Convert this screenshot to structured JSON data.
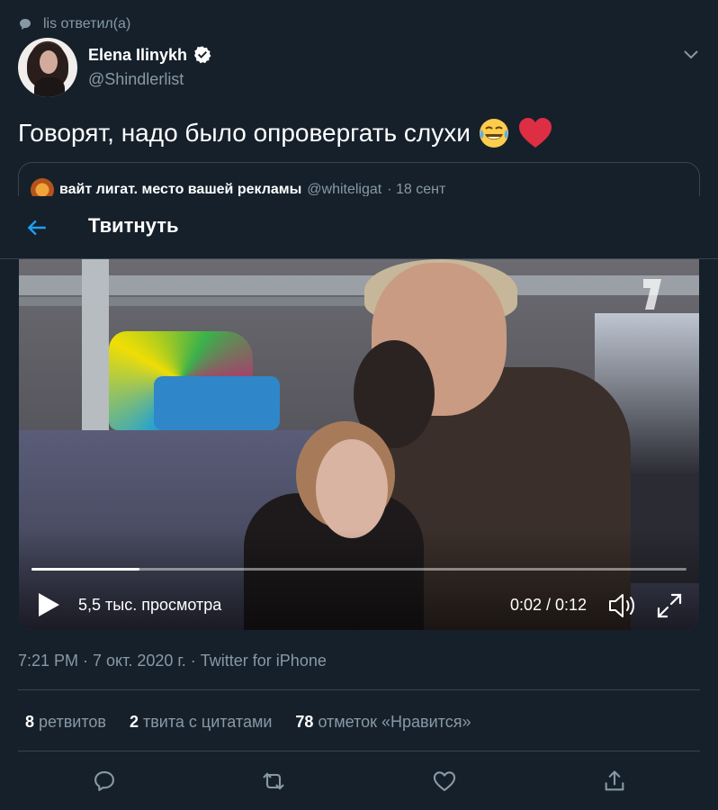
{
  "reply_context": {
    "text": "lis ответил(а)"
  },
  "author": {
    "name": "Elena Ilinykh",
    "handle": "@Shindlerlist",
    "verified": true
  },
  "tweet": {
    "text": "Говорят, надо было опровергать слухи",
    "emojis": [
      "😂",
      "❤️"
    ]
  },
  "quoted_tweet": {
    "name": "вайт лигат. место вашей рекламы",
    "handle": "@whiteligat",
    "date": "· 18 сент"
  },
  "overlay": {
    "title": "Твитнуть",
    "back_icon": "arrow-left-icon"
  },
  "video": {
    "views": "5,5 тыс. просмотра",
    "timecode": "0:02 / 0:12",
    "progress": 0.165,
    "channel_logo_icon": "channel-one-logo"
  },
  "meta": {
    "text": "7:21 PM · 7 окт. 2020 г. · Twitter for iPhone"
  },
  "stats": [
    {
      "count": "8",
      "label": "ретвитов"
    },
    {
      "count": "2",
      "label": "твита с цитатами"
    },
    {
      "count": "78",
      "label": "отметок «Нравится»"
    }
  ],
  "actions": [
    "reply-icon",
    "retweet-icon",
    "like-icon",
    "share-icon"
  ],
  "colors": {
    "background": "#15202b",
    "accent": "#1da1f2",
    "muted": "#8899a6",
    "heart": "#e0245e"
  }
}
